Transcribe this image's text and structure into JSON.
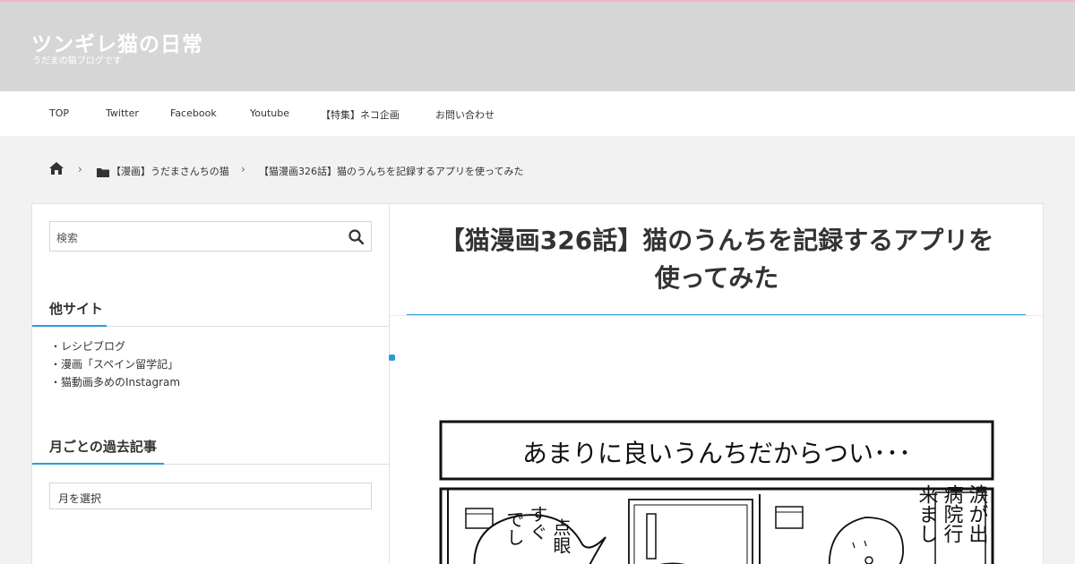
{
  "header": {
    "site_title": "ツンギレ猫の日常",
    "site_description": "うだまの猫ブログです"
  },
  "nav": {
    "items": [
      {
        "label": "TOP"
      },
      {
        "label": "Twitter"
      },
      {
        "label": "Facebook"
      },
      {
        "label": "Youtube"
      },
      {
        "label": "【特集】ネコ企画"
      },
      {
        "label": "お問い合わせ"
      }
    ]
  },
  "breadcrumb": {
    "home_icon": "home-icon",
    "category_icon": "folder-icon",
    "category": "【漫画】うだまさんちの猫",
    "current": "【猫漫画326話】猫のうんちを記録するアプリを使ってみた"
  },
  "sidebar": {
    "search_placeholder": "検索",
    "other_sites": {
      "title": "他サイト",
      "links": [
        "・レシピブログ",
        "・漫画「スペイン留学記」",
        "・猫動画多めのInstagram"
      ]
    },
    "archive": {
      "title": "月ごとの過去記事",
      "select_label": "月を選択"
    }
  },
  "post": {
    "title_line1": "【猫漫画326話】猫のうんちを記録するアプリを",
    "title_line2": "使ってみた"
  },
  "comic": {
    "caption": "あまりに良いうんちだからつい･･･",
    "bubble_left_col1": "点眼",
    "bubble_left_col2": "すぐ",
    "bubble_left_col3": "でし",
    "right_col1": "涙が出",
    "right_col2": "病院行",
    "right_col3": "来まし"
  },
  "colors": {
    "accent": "#2d9bd5",
    "header_bg": "#d6d6d6",
    "top_line": "#f4b6c8"
  }
}
